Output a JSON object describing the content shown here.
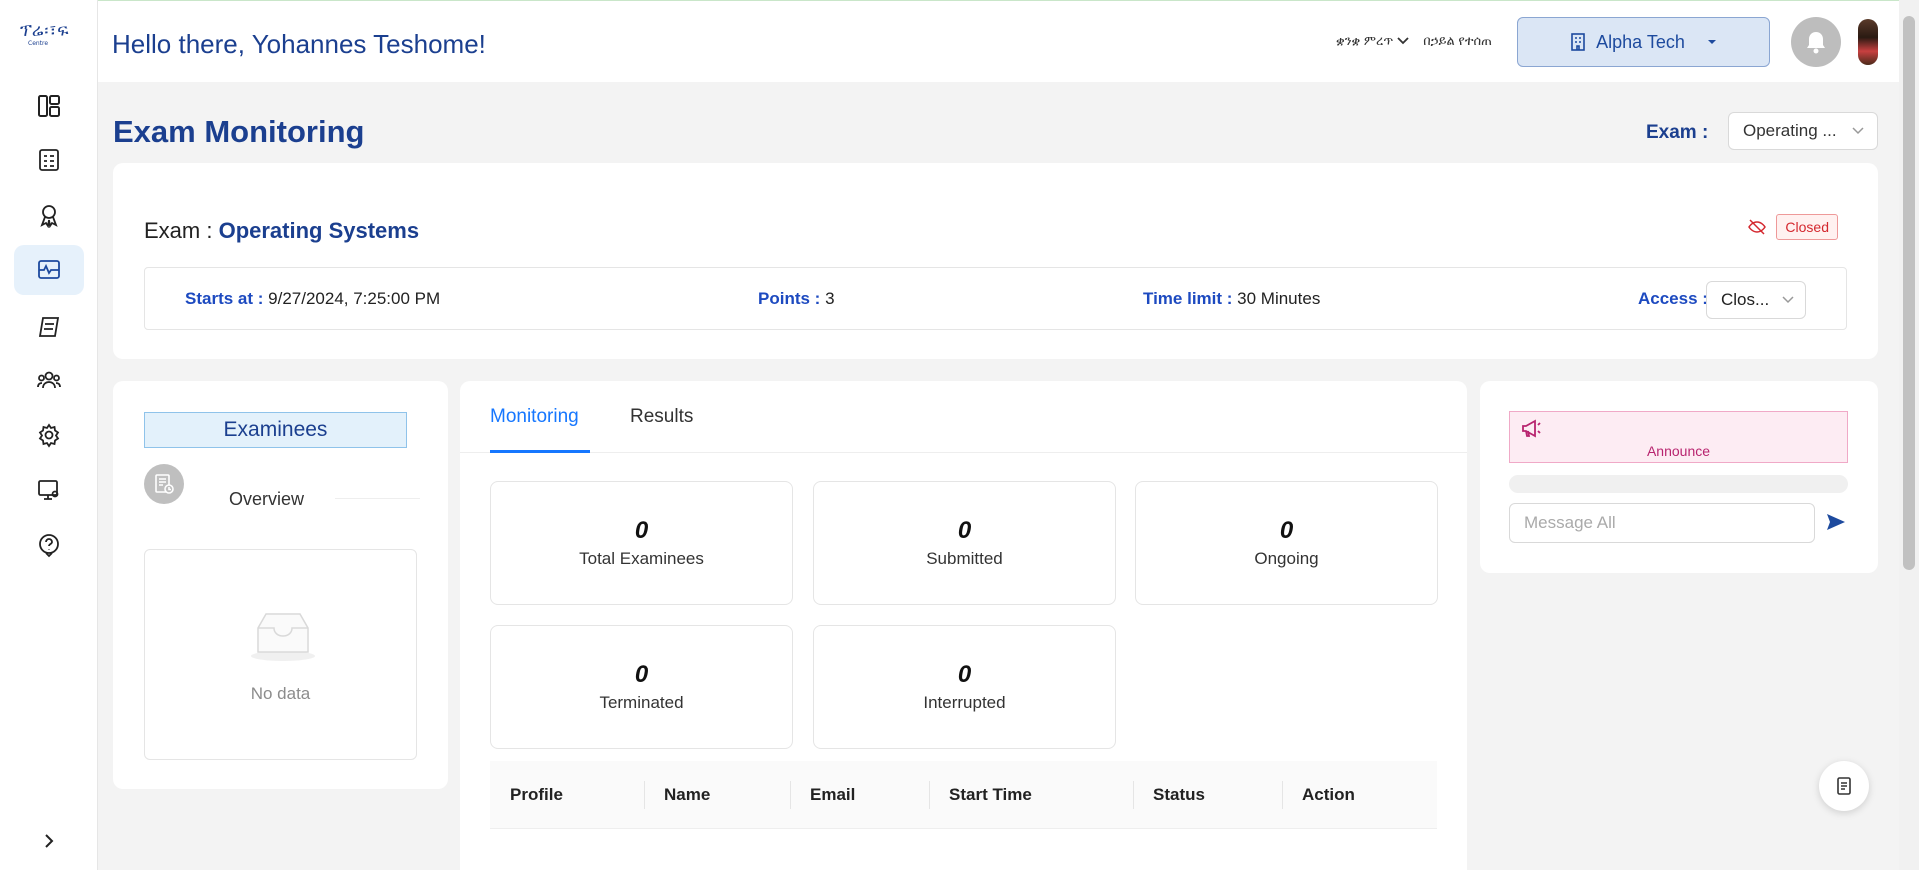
{
  "header": {
    "greeting": "Hello there, Yohannes Teshome!",
    "language_label": "ቋንቋ ምረጥ",
    "language_option": "በኃይል የተሰጠ",
    "org_name": "Alpha Tech"
  },
  "sidebar": {
    "items": [
      {
        "icon": "dashboard-icon"
      },
      {
        "icon": "exams-icon"
      },
      {
        "icon": "certificate-icon"
      },
      {
        "icon": "monitoring-icon",
        "active": true
      },
      {
        "icon": "results-icon"
      },
      {
        "icon": "users-icon"
      },
      {
        "icon": "settings-icon"
      },
      {
        "icon": "presentation-icon"
      },
      {
        "icon": "help-icon"
      }
    ]
  },
  "page": {
    "title": "Exam Monitoring",
    "exam_select_label": "Exam :",
    "exam_select_value": "Operating ..."
  },
  "exam": {
    "heading_label": "Exam : ",
    "name": "Operating Systems",
    "status": "Closed",
    "starts_at_label": "Starts at : ",
    "starts_at": "9/27/2024, 7:25:00 PM",
    "points_label": "Points : ",
    "points": "3",
    "time_limit_label": "Time limit : ",
    "time_limit": "30 Minutes",
    "access_label": "Access : ",
    "access_value": "Clos..."
  },
  "examinees": {
    "button": "Examinees",
    "overview": "Overview",
    "empty_text": "No data"
  },
  "tabs": [
    "Monitoring",
    "Results"
  ],
  "stats": [
    {
      "value": "0",
      "label": "Total Examinees"
    },
    {
      "value": "0",
      "label": "Submitted"
    },
    {
      "value": "0",
      "label": "Ongoing"
    },
    {
      "value": "0",
      "label": "Terminated"
    },
    {
      "value": "0",
      "label": "Interrupted"
    }
  ],
  "table": {
    "columns": [
      "Profile",
      "Name",
      "Email",
      "Start Time",
      "Status",
      "Action"
    ]
  },
  "announce": {
    "label": "Announce",
    "placeholder": "Message All",
    "progress": 0
  },
  "colors": {
    "primary": "#1b3f8f",
    "accent": "#1677ff",
    "closed": "#d4282f",
    "announce": "#b8246f"
  }
}
